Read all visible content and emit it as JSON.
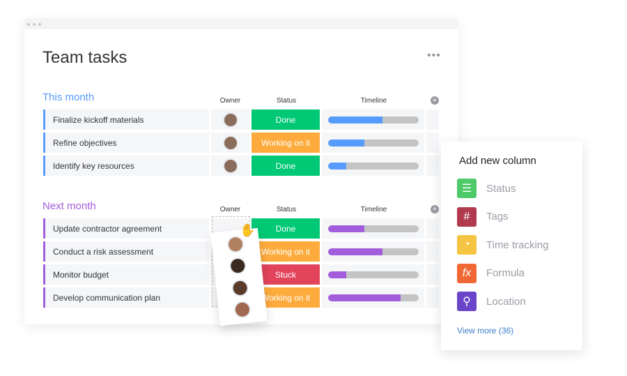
{
  "board": {
    "title": "Team tasks",
    "menu": "•••",
    "columns": {
      "owner": "Owner",
      "status": "Status",
      "timeline": "Timeline"
    },
    "groups": [
      {
        "name": "This month",
        "color": "#579bfc",
        "items": [
          {
            "task": "Finalize kickoff materials",
            "status": "Done",
            "status_color": "#00c875",
            "progress": 0.6
          },
          {
            "task": "Refine objectives",
            "status": "Working on it",
            "status_color": "#fdab3d",
            "progress": 0.4
          },
          {
            "task": "Identify key resources",
            "status": "Done",
            "status_color": "#00c875",
            "progress": 0.2
          }
        ]
      },
      {
        "name": "Next month",
        "color": "#a25ddc",
        "items": [
          {
            "task": "Update contractor agreement",
            "status": "Done",
            "status_color": "#00c875",
            "progress": 0.4
          },
          {
            "task": "Conduct a risk assessment",
            "status": "Working on it",
            "status_color": "#fdab3d",
            "progress": 0.6
          },
          {
            "task": "Monitor budget",
            "status": "Stuck",
            "status_color": "#e2445c",
            "progress": 0.2
          },
          {
            "task": "Develop communication plan",
            "status": "Working on it",
            "status_color": "#fdab3d",
            "progress": 0.8
          }
        ]
      }
    ]
  },
  "popup": {
    "title": "Add new column",
    "options": [
      {
        "label": "Status",
        "icon": "status-icon",
        "color": "#4eca6a"
      },
      {
        "label": "Tags",
        "icon": "hash-icon",
        "color": "#b13a4e"
      },
      {
        "label": "Time tracking",
        "icon": "clock-icon",
        "color": "#f6c443"
      },
      {
        "label": "Formula",
        "icon": "fx-icon",
        "color": "#f06935"
      },
      {
        "label": "Location",
        "icon": "pin-icon",
        "color": "#6b45c9"
      }
    ],
    "view_more": "View more (36)"
  }
}
